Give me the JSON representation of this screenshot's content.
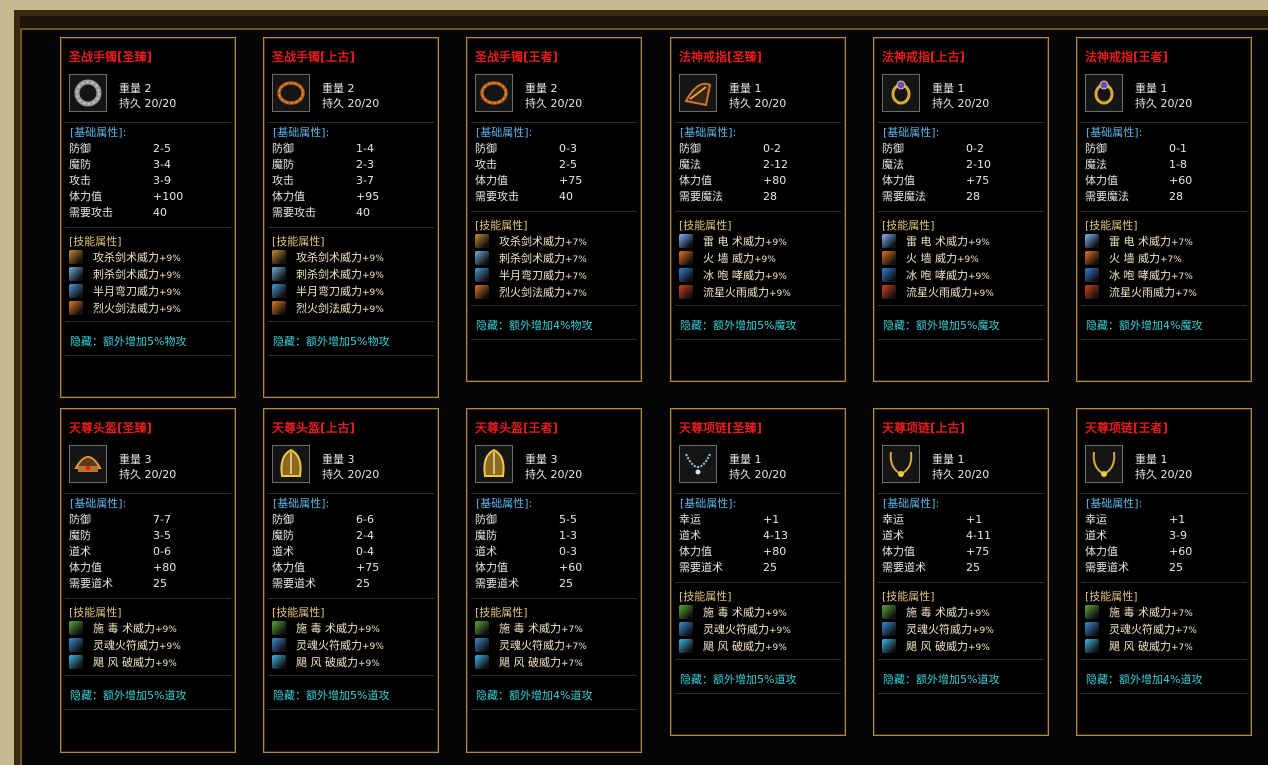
{
  "labels": {
    "weight": "重量",
    "durability": "持久",
    "base_header": "[基础属性]:",
    "skill_header": "[技能属性]"
  },
  "items": [
    {
      "title": "圣战手镯[圣臻]",
      "icon": "bracelet-spiked-icon",
      "weight": "2",
      "durability": "20/20",
      "stats": [
        [
          "防御",
          "2-5"
        ],
        [
          "魔防",
          "3-4"
        ],
        [
          "攻击",
          "3-9"
        ],
        [
          "体力值",
          "+100"
        ],
        [
          "需要攻击",
          "40"
        ]
      ],
      "skills": [
        [
          "攻杀剑术威力",
          "+9%",
          "#c98a2e"
        ],
        [
          "刺杀剑术威力",
          "+9%",
          "#6fb0d8"
        ],
        [
          "半月弯刀威力",
          "+9%",
          "#4a9ad8"
        ],
        [
          "烈火剑法威力",
          "+9%",
          "#e07a1c"
        ]
      ],
      "hidden": "隐藏：额外增加5%物攻"
    },
    {
      "title": "圣战手镯[上古]",
      "icon": "bracelet-ring-icon",
      "weight": "2",
      "durability": "20/20",
      "stats": [
        [
          "防御",
          "1-4"
        ],
        [
          "魔防",
          "2-3"
        ],
        [
          "攻击",
          "3-7"
        ],
        [
          "体力值",
          "+95"
        ],
        [
          "需要攻击",
          "40"
        ]
      ],
      "skills": [
        [
          "攻杀剑术威力",
          "+9%",
          "#c98a2e"
        ],
        [
          "刺杀剑术威力",
          "+9%",
          "#6fb0d8"
        ],
        [
          "半月弯刀威力",
          "+9%",
          "#4a9ad8"
        ],
        [
          "烈火剑法威力",
          "+9%",
          "#e07a1c"
        ]
      ],
      "hidden": "隐藏：额外增加5%物攻"
    },
    {
      "title": "圣战手镯[王者]",
      "icon": "bracelet-ring-icon",
      "weight": "2",
      "durability": "20/20",
      "stats": [
        [
          "防御",
          "0-3"
        ],
        [
          "攻击",
          "2-5"
        ],
        [
          "体力值",
          "+75"
        ],
        [
          "需要攻击",
          "40"
        ]
      ],
      "skills": [
        [
          "攻杀剑术威力",
          "+7%",
          "#c98a2e"
        ],
        [
          "刺杀剑术威力",
          "+7%",
          "#6fb0d8"
        ],
        [
          "半月弯刀威力",
          "+7%",
          "#4a9ad8"
        ],
        [
          "烈火剑法威力",
          "+7%",
          "#e07a1c"
        ]
      ],
      "hidden": "隐藏：额外增加4%物攻"
    },
    {
      "title": "法神戒指[圣臻]",
      "icon": "ring-claw-icon",
      "weight": "1",
      "durability": "20/20",
      "stats": [
        [
          "防御",
          "0-2"
        ],
        [
          "魔法",
          "2-12"
        ],
        [
          "体力值",
          "+80"
        ],
        [
          "需要魔法",
          "28"
        ]
      ],
      "skills": [
        [
          "雷 电 术威力",
          "+9%",
          "#7fb8ff"
        ],
        [
          "火  墙  威力",
          "+9%",
          "#e8741a"
        ],
        [
          "冰 咆 哮威力",
          "+9%",
          "#2f7fd8"
        ],
        [
          "流星火雨威力",
          "+9%",
          "#d8401a"
        ]
      ],
      "hidden": "隐藏：额外增加5%魔攻"
    },
    {
      "title": "法神戒指[上古]",
      "icon": "ring-gold-icon",
      "weight": "1",
      "durability": "20/20",
      "stats": [
        [
          "防御",
          "0-2"
        ],
        [
          "魔法",
          "2-10"
        ],
        [
          "体力值",
          "+75"
        ],
        [
          "需要魔法",
          "28"
        ]
      ],
      "skills": [
        [
          "雷 电 术威力",
          "+9%",
          "#7fb8ff"
        ],
        [
          "火  墙  威力",
          "+9%",
          "#e8741a"
        ],
        [
          "冰 咆 哮威力",
          "+9%",
          "#2f7fd8"
        ],
        [
          "流星火雨威力",
          "+9%",
          "#d8401a"
        ]
      ],
      "hidden": "隐藏：额外增加5%魔攻"
    },
    {
      "title": "法神戒指[王者]",
      "icon": "ring-gold-icon",
      "weight": "1",
      "durability": "20/20",
      "stats": [
        [
          "防御",
          "0-1"
        ],
        [
          "魔法",
          "1-8"
        ],
        [
          "体力值",
          "+60"
        ],
        [
          "需要魔法",
          "28"
        ]
      ],
      "skills": [
        [
          "雷 电 术威力",
          "+7%",
          "#7fb8ff"
        ],
        [
          "火  墙  威力",
          "+7%",
          "#e8741a"
        ],
        [
          "冰 咆 哮威力",
          "+7%",
          "#2f7fd8"
        ],
        [
          "流星火雨威力",
          "+7%",
          "#d8401a"
        ]
      ],
      "hidden": "隐藏：额外增加4%魔攻"
    },
    {
      "title": "天尊头盔[圣臻]",
      "icon": "helmet-icon",
      "weight": "3",
      "durability": "20/20",
      "stats": [
        [
          "防御",
          "7-7"
        ],
        [
          "魔防",
          "3-5"
        ],
        [
          "道术",
          "0-6"
        ],
        [
          "体力值",
          "+80"
        ],
        [
          "需要道术",
          "25"
        ]
      ],
      "skills": [
        [
          "施 毒 术威力",
          "+9%",
          "#5aa83a"
        ],
        [
          "灵魂火符威力",
          "+9%",
          "#3a8ad8"
        ],
        [
          "飓 风 破威力",
          "+9%",
          "#3ab8e8"
        ]
      ],
      "hidden": "隐藏：额外增加5%道攻"
    },
    {
      "title": "天尊头盔[上古]",
      "icon": "helmet-gold-icon",
      "weight": "3",
      "durability": "20/20",
      "stats": [
        [
          "防御",
          "6-6"
        ],
        [
          "魔防",
          "2-4"
        ],
        [
          "道术",
          "0-4"
        ],
        [
          "体力值",
          "+75"
        ],
        [
          "需要道术",
          "25"
        ]
      ],
      "skills": [
        [
          "施 毒 术威力",
          "+9%",
          "#5aa83a"
        ],
        [
          "灵魂火符威力",
          "+9%",
          "#3a8ad8"
        ],
        [
          "飓 风 破威力",
          "+9%",
          "#3ab8e8"
        ]
      ],
      "hidden": "隐藏：额外增加5%道攻"
    },
    {
      "title": "天尊头盔[王者]",
      "icon": "helmet-gold-icon",
      "weight": "3",
      "durability": "20/20",
      "stats": [
        [
          "防御",
          "5-5"
        ],
        [
          "魔防",
          "1-3"
        ],
        [
          "道术",
          "0-3"
        ],
        [
          "体力值",
          "+60"
        ],
        [
          "需要道术",
          "25"
        ]
      ],
      "skills": [
        [
          "施 毒 术威力",
          "+7%",
          "#5aa83a"
        ],
        [
          "灵魂火符威力",
          "+7%",
          "#3a8ad8"
        ],
        [
          "飓 风 破威力",
          "+7%",
          "#3ab8e8"
        ]
      ],
      "hidden": "隐藏：额外增加4%道攻"
    },
    {
      "title": "天尊项链[圣臻]",
      "icon": "necklace-chain-icon",
      "weight": "1",
      "durability": "20/20",
      "stats": [
        [
          "幸运",
          "+1"
        ],
        [
          "道术",
          "4-13"
        ],
        [
          "体力值",
          "+80"
        ],
        [
          "需要道术",
          "25"
        ]
      ],
      "skills": [
        [
          "施 毒 术威力",
          "+9%",
          "#5aa83a"
        ],
        [
          "灵魂火符威力",
          "+9%",
          "#3a8ad8"
        ],
        [
          "飓 风 破威力",
          "+9%",
          "#3ab8e8"
        ]
      ],
      "hidden": "隐藏：额外增加5%道攻"
    },
    {
      "title": "天尊项链[上古]",
      "icon": "necklace-gold-icon",
      "weight": "1",
      "durability": "20/20",
      "stats": [
        [
          "幸运",
          "+1"
        ],
        [
          "道术",
          "4-11"
        ],
        [
          "体力值",
          "+75"
        ],
        [
          "需要道术",
          "25"
        ]
      ],
      "skills": [
        [
          "施 毒 术威力",
          "+9%",
          "#5aa83a"
        ],
        [
          "灵魂火符威力",
          "+9%",
          "#3a8ad8"
        ],
        [
          "飓 风 破威力",
          "+9%",
          "#3ab8e8"
        ]
      ],
      "hidden": "隐藏：额外增加5%道攻"
    },
    {
      "title": "天尊项链[王者]",
      "icon": "necklace-gold-icon",
      "weight": "1",
      "durability": "20/20",
      "stats": [
        [
          "幸运",
          "+1"
        ],
        [
          "道术",
          "3-9"
        ],
        [
          "体力值",
          "+60"
        ],
        [
          "需要道术",
          "25"
        ]
      ],
      "skills": [
        [
          "施 毒 术威力",
          "+7%",
          "#5aa83a"
        ],
        [
          "灵魂火符威力",
          "+7%",
          "#3a8ad8"
        ],
        [
          "飓 风 破威力",
          "+7%",
          "#3ab8e8"
        ]
      ],
      "hidden": "隐藏：额外增加4%道攻"
    }
  ]
}
